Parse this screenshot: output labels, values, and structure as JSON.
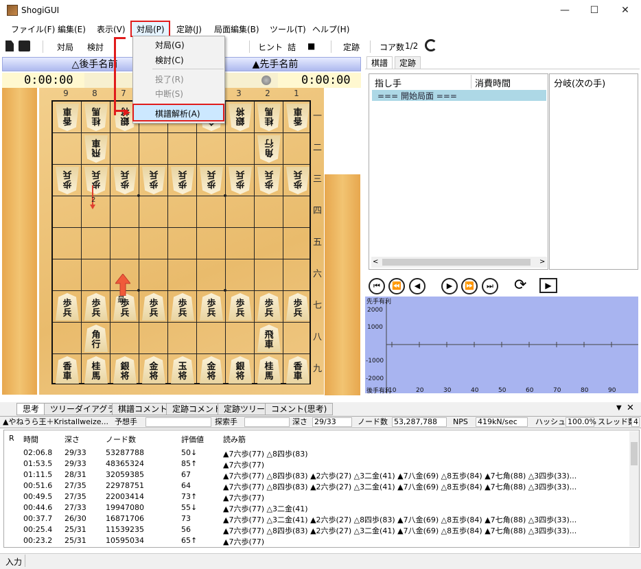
{
  "window": {
    "title": "ShogiGUI",
    "controls": [
      "—",
      "☐",
      "✕"
    ]
  },
  "menu": [
    "ファイル(F)",
    "編集(E)",
    "表示(V)",
    "対局(P)",
    "定跡(J)",
    "局面編集(B)",
    "ツール(T)",
    "ヘルプ(H)"
  ],
  "toolbar": {
    "items": [
      "対局",
      "検討",
      "ヒント",
      "詰",
      "■",
      "定跡",
      "コア数",
      "1/2"
    ]
  },
  "dropdown": {
    "items": [
      "対局(G)",
      "検討(C)",
      "投了(R)",
      "中断(S)",
      "棋譜解析(A)"
    ]
  },
  "players": {
    "gote": "△後手名前",
    "sente": "▲先手名前",
    "gote_time": "0:00:00",
    "sente_time": "0:00:00"
  },
  "board": {
    "col_labels": [
      "9",
      "8",
      "7",
      "6",
      "5",
      "4",
      "3",
      "2",
      "1"
    ],
    "row_labels": [
      "一",
      "二",
      "三",
      "四",
      "五",
      "六",
      "七",
      "八",
      "九"
    ],
    "pieces": [
      {
        "c": 0,
        "r": 0,
        "t": "香車",
        "g": true
      },
      {
        "c": 1,
        "r": 0,
        "t": "桂馬",
        "g": true
      },
      {
        "c": 2,
        "r": 0,
        "t": "銀将",
        "g": true
      },
      {
        "c": 5,
        "r": 0,
        "t": "金将",
        "g": true
      },
      {
        "c": 6,
        "r": 0,
        "t": "銀将",
        "g": true
      },
      {
        "c": 7,
        "r": 0,
        "t": "桂馬",
        "g": true
      },
      {
        "c": 8,
        "r": 0,
        "t": "香車",
        "g": true
      },
      {
        "c": 1,
        "r": 1,
        "t": "飛車",
        "g": true
      },
      {
        "c": 7,
        "r": 1,
        "t": "角行",
        "g": true
      },
      {
        "c": 0,
        "r": 2,
        "t": "歩兵",
        "g": true
      },
      {
        "c": 1,
        "r": 2,
        "t": "歩兵",
        "g": true
      },
      {
        "c": 2,
        "r": 2,
        "t": "歩兵",
        "g": true
      },
      {
        "c": 3,
        "r": 2,
        "t": "歩兵",
        "g": true
      },
      {
        "c": 4,
        "r": 2,
        "t": "歩兵",
        "g": true
      },
      {
        "c": 5,
        "r": 2,
        "t": "歩兵",
        "g": true
      },
      {
        "c": 6,
        "r": 2,
        "t": "歩兵",
        "g": true
      },
      {
        "c": 7,
        "r": 2,
        "t": "歩兵",
        "g": true
      },
      {
        "c": 8,
        "r": 2,
        "t": "歩兵",
        "g": true
      },
      {
        "c": 0,
        "r": 6,
        "t": "歩兵",
        "g": false
      },
      {
        "c": 1,
        "r": 6,
        "t": "歩兵",
        "g": false
      },
      {
        "c": 2,
        "r": 6,
        "t": "歩兵",
        "g": false
      },
      {
        "c": 3,
        "r": 6,
        "t": "歩兵",
        "g": false
      },
      {
        "c": 4,
        "r": 6,
        "t": "歩兵",
        "g": false
      },
      {
        "c": 5,
        "r": 6,
        "t": "歩兵",
        "g": false
      },
      {
        "c": 6,
        "r": 6,
        "t": "歩兵",
        "g": false
      },
      {
        "c": 7,
        "r": 6,
        "t": "歩兵",
        "g": false
      },
      {
        "c": 8,
        "r": 6,
        "t": "歩兵",
        "g": false
      },
      {
        "c": 1,
        "r": 7,
        "t": "角行",
        "g": false
      },
      {
        "c": 7,
        "r": 7,
        "t": "飛車",
        "g": false
      },
      {
        "c": 0,
        "r": 8,
        "t": "香車",
        "g": false
      },
      {
        "c": 1,
        "r": 8,
        "t": "桂馬",
        "g": false
      },
      {
        "c": 2,
        "r": 8,
        "t": "銀将",
        "g": false
      },
      {
        "c": 3,
        "r": 8,
        "t": "金将",
        "g": false
      },
      {
        "c": 4,
        "r": 8,
        "t": "玉将",
        "g": false
      },
      {
        "c": 5,
        "r": 8,
        "t": "金将",
        "g": false
      },
      {
        "c": 6,
        "r": 8,
        "t": "銀将",
        "g": false
      },
      {
        "c": 7,
        "r": 8,
        "t": "桂馬",
        "g": false
      },
      {
        "c": 8,
        "r": 8,
        "t": "香車",
        "g": false
      }
    ],
    "hint_best": "最",
    "hint_2": "2"
  },
  "kifu": {
    "tabs": [
      "棋譜",
      "定跡"
    ],
    "col_move": "指し手",
    "col_time": "消費時間",
    "col_branch": "分岐(次の手)",
    "row0": "=== 開始局面 ==="
  },
  "nav": [
    "⏮",
    "⏪",
    "◀",
    "▶",
    "⏩",
    "⏭",
    "⟳",
    "▶"
  ],
  "graph": {
    "top_label": "先手有利",
    "bottom_label": "後手有利",
    "y_ticks": [
      "2000",
      "1000",
      "-1000",
      "-2000"
    ],
    "x_ticks": [
      "10",
      "20",
      "30",
      "40",
      "50",
      "60",
      "70",
      "80",
      "90"
    ]
  },
  "bottom_tabs": [
    "思考",
    "ツリーダイアグラム",
    "棋譜コメント",
    "定跡コメント",
    "定跡ツリー",
    "コメント(思考)"
  ],
  "engine": {
    "name": "▲やねうら王＋Kristallweize...",
    "predict_label": "予想手",
    "search_label": "探索手",
    "depth_label": "深さ",
    "depth": "29/33",
    "nodes_label": "ノード数",
    "nodes": "53,287,788",
    "nps_label": "NPS",
    "nps": "419kN/sec",
    "hash_label": "ハッシュ",
    "hash": "100.0%",
    "thread_label": "スレッド数",
    "threads": "4"
  },
  "pv": {
    "headers": [
      "R",
      "時間",
      "深さ",
      "ノード数",
      "評価値",
      "読み筋"
    ],
    "rows": [
      [
        "02:06.8",
        "29/33",
        "53287788",
        "50↓",
        "▲7六歩(77) △8四歩(83)"
      ],
      [
        "01:53.5",
        "29/33",
        "48365324",
        "85↑",
        "▲7六歩(77)"
      ],
      [
        "01:11.5",
        "28/31",
        "32059385",
        "67",
        "▲7六歩(77) △8四歩(83) ▲2六歩(27) △3二金(41) ▲7八金(69) △8五歩(84) ▲7七角(88) △3四歩(33)..."
      ],
      [
        "00:51.6",
        "27/35",
        "22978751",
        "64",
        "▲7六歩(77) △8四歩(83) ▲2六歩(27) △3二金(41) ▲7八金(69) △8五歩(84) ▲7七角(88) △3四歩(33)..."
      ],
      [
        "00:49.5",
        "27/35",
        "22003414",
        "73↑",
        "▲7六歩(77)"
      ],
      [
        "00:44.6",
        "27/33",
        "19947080",
        "55↓",
        "▲7六歩(77) △3二金(41)"
      ],
      [
        "00:37.7",
        "26/30",
        "16871706",
        "73",
        "▲7六歩(77) △3二金(41) ▲2六歩(27) △8四歩(83) ▲7八金(69) △8五歩(84) ▲7七角(88) △3四歩(33)..."
      ],
      [
        "00:25.4",
        "25/31",
        "11539235",
        "56",
        "▲7六歩(77) △8四歩(83) ▲2六歩(27) △3二金(41) ▲7八金(69) △8五歩(84) ▲7七角(88) △3四歩(33)..."
      ],
      [
        "00:23.2",
        "25/31",
        "10595034",
        "65↑",
        "▲7六歩(77)"
      ]
    ]
  },
  "status": {
    "label": "入力"
  }
}
